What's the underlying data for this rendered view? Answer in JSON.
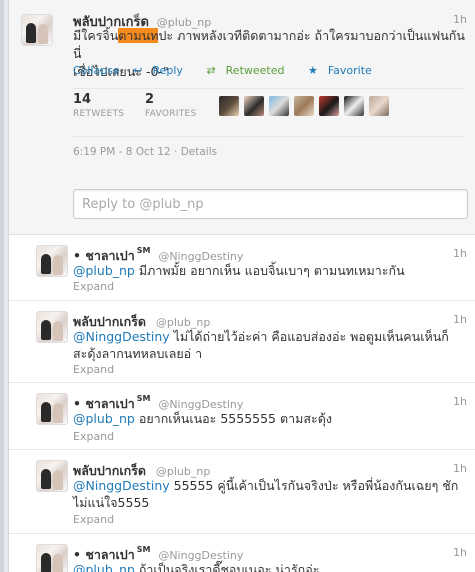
{
  "main_tweet": {
    "name": "พลับปากเกร็ด",
    "handle": "@plub_np",
    "time": "1h",
    "text_before": "มีใครจิ้น",
    "text_highlight": "ตามนท",
    "text_after": "ปะ ภาพหลังเวทีติดตามากอ่ะ ถ้าใครมาบอกว่าเป็นแฟนกันนี่",
    "text_line2": "เชื่อไปเลยนะ -0-\"",
    "actions": {
      "collapse": "Collapse",
      "reply": "Reply",
      "retweeted": "Retweeted",
      "favorite": "Favorite"
    },
    "retweets_count": "14",
    "retweets_label": "RETWEETS",
    "favorites_count": "2",
    "favorites_label": "FAVORITES",
    "timestamp": "6:19 PM - 8 Oct 12",
    "details": "Details",
    "reply_placeholder": "Reply to @plub_np"
  },
  "icons": {
    "reply": "reply-arrow-icon",
    "retweet": "retweet-icon",
    "favorite": "star-icon"
  },
  "replies": [
    {
      "name": "• ชาลาเปา",
      "sm": "SM",
      "handle": "@NinggDestiny",
      "time": "1h",
      "mention": "@plub_np",
      "text": " มีภาพมั้ย อยากเห็น แอบจิ้นเบาๆ ตามนทเหมาะกัน",
      "expand": "Expand"
    },
    {
      "name": "พลับปากเกร็ด",
      "sm": "",
      "handle": "@plub_np",
      "time": "1h",
      "mention": "@NinggDestiny",
      "text": " ไม่ได้ถ่ายไว้อ่ะค่า คือแอบส่องอ่ะ พอตูมเห็นคนเห็นก็สะดุ้งลากนทหลบเลยอ่ า",
      "expand": "Expand"
    },
    {
      "name": "• ชาลาเปา",
      "sm": "SM",
      "handle": "@NinggDestiny",
      "time": "1h",
      "mention": "@plub_np",
      "text": " อยากเห็นเนอะ 5555555 ตามสะดุ้ง",
      "expand": "Expand"
    },
    {
      "name": "พลับปากเกร็ด",
      "sm": "",
      "handle": "@plub_np",
      "time": "1h",
      "mention": "@NinggDestiny",
      "text": " 55555 คู่นี้เค้าเป็นไรกันจริงป่ะ หรือพี่น้องกันเฉยๆ ชักไม่แน่ใจ5555",
      "expand": "Expand"
    },
    {
      "name": "• ชาลาเปา",
      "sm": "SM",
      "handle": "@NinggDestiny",
      "time": "1h",
      "mention": "@plub_np",
      "text": " ถ้าเป็นจริงเราดี๊ชอบเนอะ น่ารักอ่ะ",
      "expand": ""
    }
  ],
  "colors": {
    "link": "#1f7ab8",
    "retweeted": "#5a9e3a",
    "highlight": "#f58a1f",
    "muted": "#999999"
  }
}
